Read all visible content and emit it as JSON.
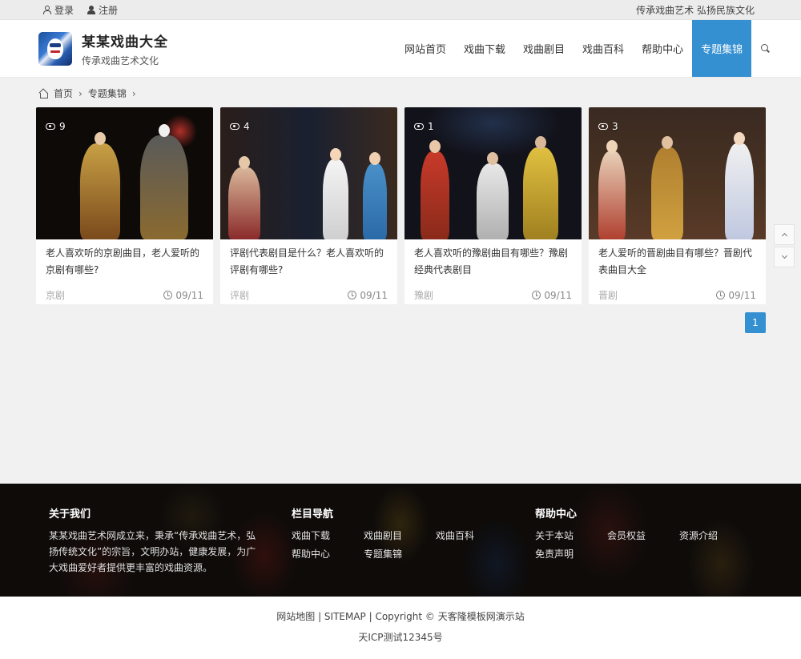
{
  "topbar": {
    "login": "登录",
    "register": "注册",
    "tagline": "传承戏曲艺术 弘扬民族文化"
  },
  "header": {
    "site_name": "某某戏曲大全",
    "slogan": "传承戏曲艺术文化",
    "nav": [
      "网站首页",
      "戏曲下载",
      "戏曲剧目",
      "戏曲百科",
      "帮助中心",
      "专题集锦"
    ],
    "active_nav": "专题集锦"
  },
  "breadcrumb": {
    "home": "首页",
    "current": "专题集锦",
    "sep": "›"
  },
  "cards": [
    {
      "views": "9",
      "title": "老人喜欢听的京剧曲目，老人爱听的京剧有哪些?",
      "category": "京剧",
      "date": "09/11",
      "tone": "#2a1510"
    },
    {
      "views": "4",
      "title": "评剧代表剧目是什么？老人喜欢听的评剧有哪些?",
      "category": "评剧",
      "date": "09/11",
      "tone": "#1e1714"
    },
    {
      "views": "1",
      "title": "老人喜欢听的豫剧曲目有哪些？豫剧经典代表剧目",
      "category": "豫剧",
      "date": "09/11",
      "tone": "#1a1a25"
    },
    {
      "views": "3",
      "title": "老人爱听的晋剧曲目有哪些？晋剧代表曲目大全",
      "category": "晋剧",
      "date": "09/11",
      "tone": "#3a2a1e"
    }
  ],
  "pagination": {
    "current": "1"
  },
  "footer": {
    "about_title": "关于我们",
    "about_text": "某某戏曲艺术网成立来，秉承“传承戏曲艺术，弘扬传统文化”的宗旨，文明办站，健康发展，为广大戏曲爱好者提供更丰富的戏曲资源。",
    "nav_title": "栏目导航",
    "nav_links": [
      "戏曲下载",
      "戏曲剧目",
      "戏曲百科",
      "帮助中心",
      "专题集锦"
    ],
    "help_title": "帮助中心",
    "help_links": [
      "关于本站",
      "会员权益",
      "资源介绍",
      "免责声明"
    ]
  },
  "copyright": {
    "line1": "网站地图 | SITEMAP | Copyright © 天客隆模板网演示站",
    "line2": "天ICP测试12345号"
  },
  "colors": {
    "accent": "#3590d1",
    "footer_bg": "#1a1512"
  }
}
